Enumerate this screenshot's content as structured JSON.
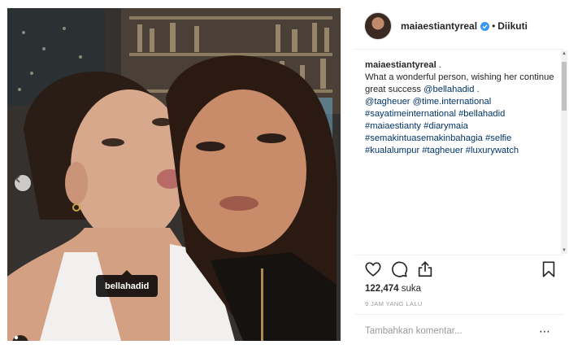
{
  "post": {
    "username": "maiaestiantyreal",
    "verified": true,
    "bullet": "•",
    "follow_label": "Diikuti",
    "more_icon": "⋯"
  },
  "caption": {
    "username": "maiaestiantyreal",
    "lead": " . ",
    "text": "What a wonderful person, wishing her continue great success ",
    "mention1": "@bellahadid",
    "after1": " . ",
    "mention2": "@tagheuer",
    "mention3": "@time.international",
    "tags": [
      "#sayatimeinternational",
      "#bellahadid",
      "#maiaestianty",
      "#diarymaia",
      "#semakintuasemakinbahagia",
      "#selfie",
      "#kualalumpur",
      "#tagheuer",
      "#luxurywatch"
    ]
  },
  "photo": {
    "tag_label": "bellahadid",
    "carousel_count": 2,
    "carousel_active": 2
  },
  "stats": {
    "likes_number": "122,474",
    "likes_word": " suka",
    "time_ago": "9 JAM YANG LALU"
  },
  "comment": {
    "placeholder": "Tambahkan komentar..."
  },
  "icons": {
    "verified": "verified-badge-icon",
    "heart": "heart-icon",
    "comment": "comment-icon",
    "share": "share-icon",
    "save": "bookmark-icon",
    "prev": "chevron-left-icon",
    "user": "user-tag-icon"
  },
  "colors": {
    "link": "#003569",
    "verified": "#3897f0",
    "text": "#262626",
    "muted": "#999999"
  }
}
